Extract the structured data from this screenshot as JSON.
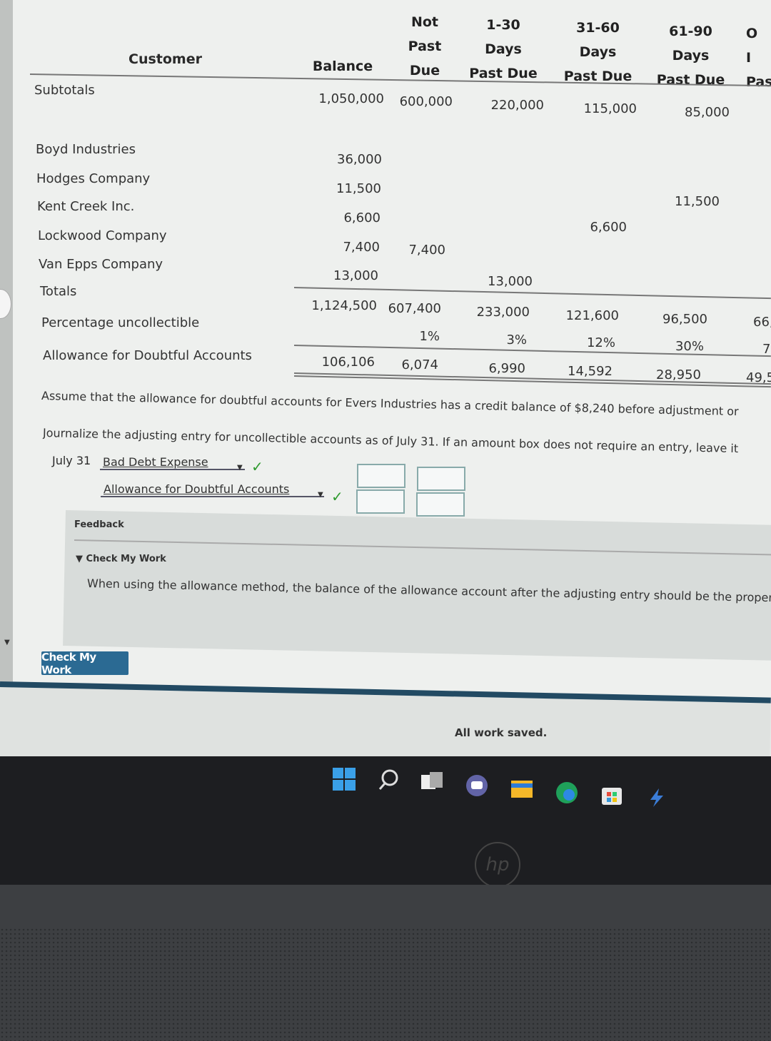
{
  "table": {
    "headers": {
      "customer": "Customer",
      "balance": "Balance",
      "not_past_due": [
        "Not",
        "Past",
        "Due"
      ],
      "d1_30": [
        "1-30",
        "Days",
        "Past Due"
      ],
      "d31_60": [
        "31-60",
        "Days",
        "Past Due"
      ],
      "d61_90": [
        "61-90",
        "Days",
        "Past Due"
      ],
      "over90_partial": [
        "O",
        "I",
        "Pas"
      ]
    },
    "subtotals": {
      "label": "Subtotals",
      "balance": "1,050,000",
      "not_past_due": "600,000",
      "d1_30": "220,000",
      "d31_60": "115,000",
      "d61_90": "85,000"
    },
    "rows": [
      {
        "customer": "Boyd Industries",
        "balance": "36,000"
      },
      {
        "customer": "Hodges Company",
        "balance": "11,500",
        "d61_90": "11,500"
      },
      {
        "customer": "Kent Creek Inc.",
        "balance": "6,600",
        "d31_60": "6,600"
      },
      {
        "customer": "Lockwood Company",
        "balance": "7,400",
        "not_past_due": "7,400"
      },
      {
        "customer": "Van Epps Company",
        "balance": "13,000",
        "d1_30": "13,000"
      }
    ],
    "totals": {
      "label": "Totals",
      "balance": "1,124,500",
      "not_past_due": "607,400",
      "d1_30": "233,000",
      "d31_60": "121,600",
      "d61_90": "96,500",
      "over90_partial": "66,"
    },
    "percentages": {
      "label": "Percentage uncollectible",
      "not_past_due": "1%",
      "d1_30": "3%",
      "d31_60": "12%",
      "d61_90": "30%",
      "over90_partial": "7"
    },
    "allowance": {
      "label": "Allowance for Doubtful Accounts",
      "balance": "106,106",
      "not_past_due": "6,074",
      "d1_30": "6,990",
      "d31_60": "14,592",
      "d61_90": "28,950",
      "over90_partial": "49,5"
    }
  },
  "instructions": {
    "assume": "Assume that the allowance for doubtful accounts for Evers Industries has a credit balance of $8,240 before adjustment or",
    "journalize": "Journalize the adjusting entry for uncollectible accounts as of July 31. If an amount box does not require an entry, leave it"
  },
  "journal": {
    "date": "July 31",
    "debit_account": "Bad Debt Expense",
    "credit_account": "Allowance for Doubtful Accounts",
    "debit_amount": "",
    "credit_amount": ""
  },
  "feedback": {
    "label": "Feedback",
    "section_title": "Check My Work",
    "text": "When using the allowance method, the balance of the allowance account after the adjusting entry should be the proper"
  },
  "buttons": {
    "check_my_work": "Check My Work"
  },
  "status": {
    "saved": "All work saved."
  },
  "colors": {
    "check_button": "#2b6a93",
    "checkmark": "#2e9a2e",
    "taskbar": "#1d1e21"
  },
  "taskbar_icons": [
    "windows-start-icon",
    "search-icon",
    "task-view-icon",
    "teams-chat-icon",
    "file-explorer-icon",
    "edge-browser-icon",
    "store-icon",
    "app-icon"
  ]
}
